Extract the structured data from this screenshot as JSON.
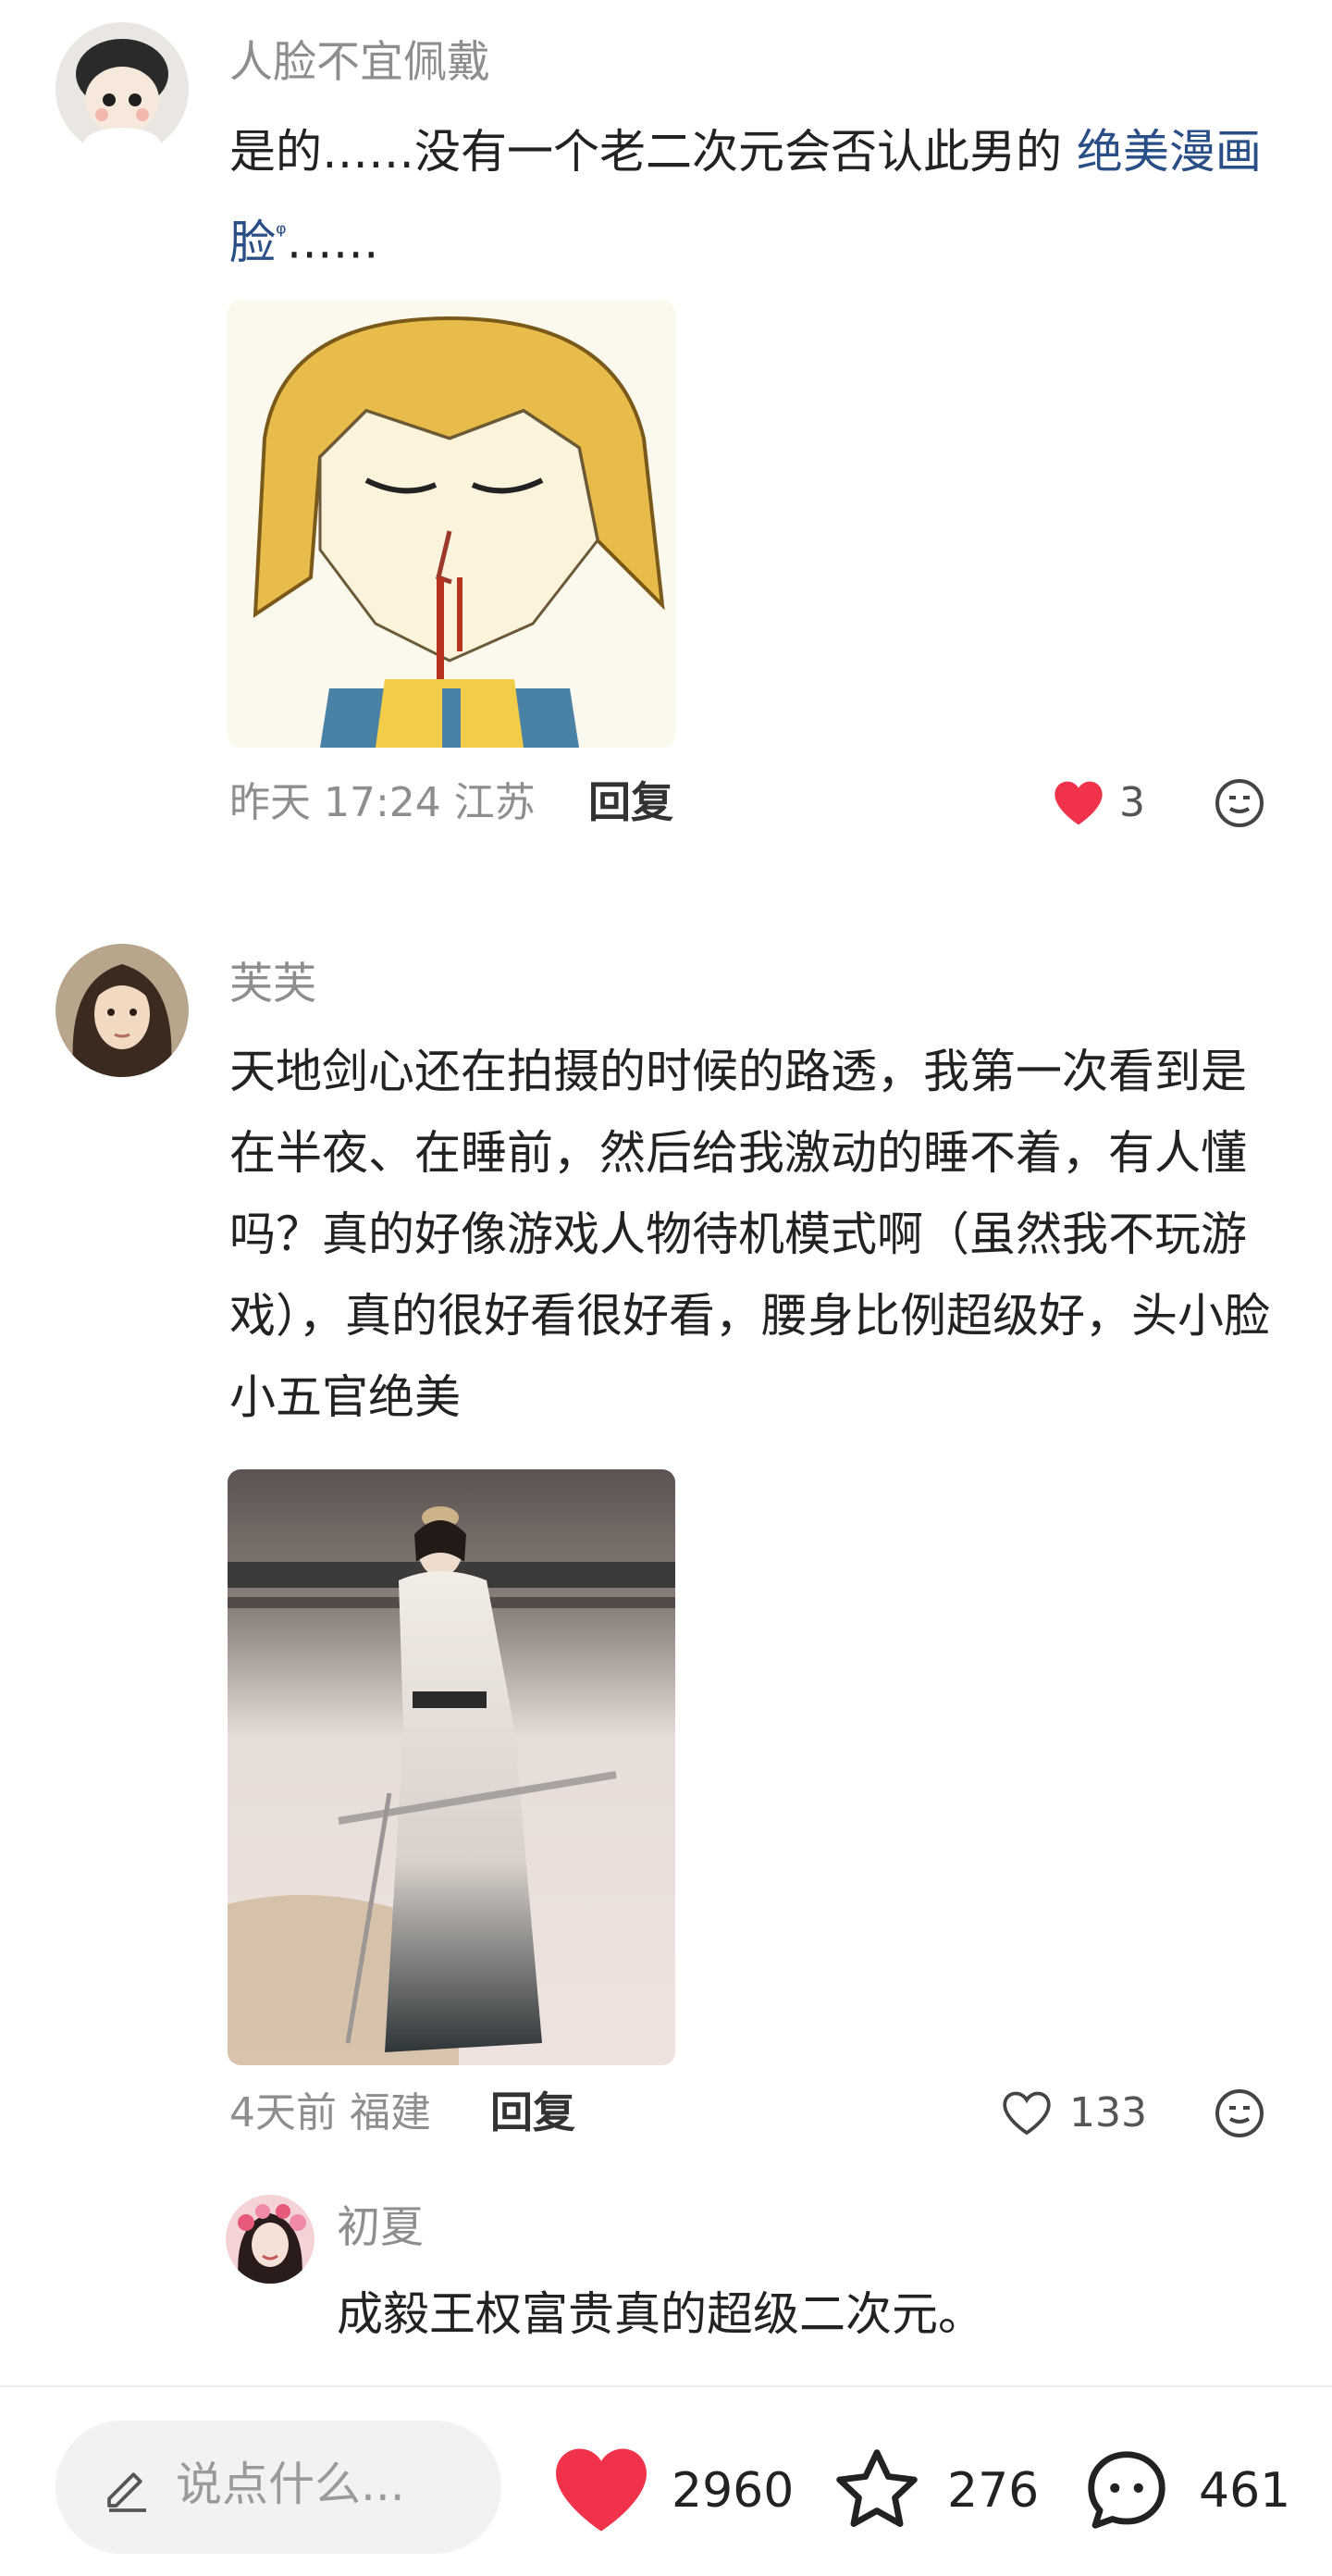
{
  "comments": [
    {
      "username": "人脸不宜佩戴",
      "text_before": "是的……没有一个老二次元会否认此男的 ",
      "link_text": "绝美漫画脸",
      "text_after": "……",
      "time_loc": "昨天 17:24 江苏",
      "reply_label": "回复",
      "like_count": "3",
      "liked": true
    },
    {
      "username": "芙芙",
      "text": "天地剑心还在拍摄的时候的路透，我第一次看到是在半夜、在睡前，然后给我激动的睡不着，有人懂吗？真的好像游戏人物待机模式啊（虽然我不玩游戏），真的很好看很好看，腰身比例超级好，头小脸小五官绝美",
      "time_loc": "4天前 福建",
      "reply_label": "回复",
      "like_count": "133",
      "liked": false
    }
  ],
  "reply": {
    "username": "初夏",
    "text": "成毅王权富贵真的超级二次元。"
  },
  "bottom_bar": {
    "input_placeholder": "说点什么...",
    "likes": "2960",
    "favorites": "276",
    "comments": "461"
  },
  "colors": {
    "like_red": "#f0334a",
    "link_blue": "#2a4f86",
    "muted_gray": "#8e8e8e"
  }
}
